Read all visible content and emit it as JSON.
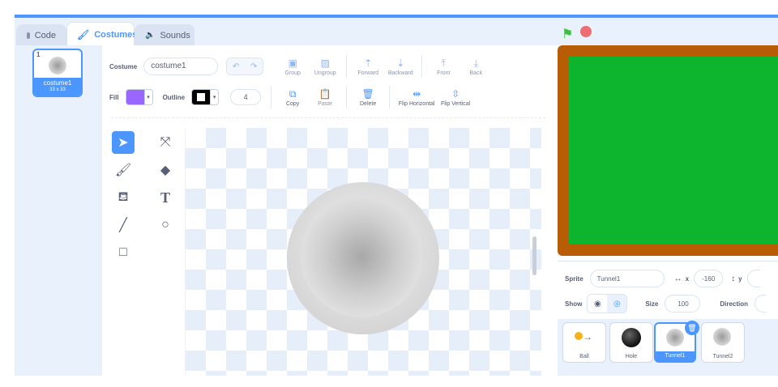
{
  "tabs": [
    {
      "label": "Code",
      "icon": "code-icon"
    },
    {
      "label": "Costumes",
      "icon": "brush-icon"
    },
    {
      "label": "Sounds",
      "icon": "speaker-icon"
    }
  ],
  "costume_list": [
    {
      "number": "1",
      "name": "costume1",
      "size": "33 x 33"
    }
  ],
  "toolbar": {
    "costume_label": "Costume",
    "costume_name": "costume1",
    "group": "Group",
    "ungroup": "Ungroup",
    "forward": "Forward",
    "backward": "Backward",
    "front": "Front",
    "back": "Back",
    "fill_label": "Fill",
    "fill_color": "#9966ff",
    "outline_label": "Outline",
    "outline_color": "#000000",
    "outline_width": "4",
    "copy": "Copy",
    "paste": "Paste",
    "delete": "Delete",
    "flip_horizontal": "Flip Horizontal",
    "flip_vertical": "Flip Vertical"
  },
  "tools": [
    "select-icon",
    "reshape-icon",
    "brush-icon",
    "eraser-icon",
    "fill-icon",
    "text-icon",
    "line-icon",
    "circle-icon",
    "rectangle-icon"
  ],
  "text_tool_glyph": "T",
  "stage": {
    "border_color": "#b85c06",
    "fill_color": "#0db52f"
  },
  "sprite_info": {
    "sprite_label": "Sprite",
    "sprite_name": "Tunnel1",
    "x_label": "x",
    "x_value": "-160",
    "y_label": "y",
    "show_label": "Show",
    "size_label": "Size",
    "size_value": "100",
    "direction_label": "Direction"
  },
  "sprites": [
    {
      "name": "Ball",
      "selected": false
    },
    {
      "name": "Hole",
      "selected": false
    },
    {
      "name": "Tunnel1",
      "selected": true
    },
    {
      "name": "Tunnel2",
      "selected": false
    }
  ],
  "colors": {
    "accent": "#4c97ff",
    "panel": "#e9f1fc"
  }
}
